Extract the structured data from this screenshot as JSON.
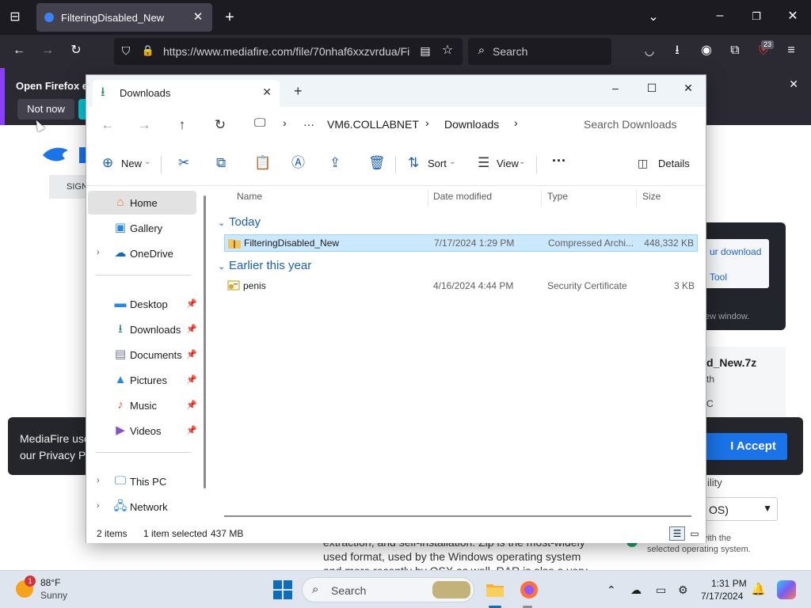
{
  "browser": {
    "tab_title": "FilteringDisabled_New",
    "url": "https://www.mediafire.com/file/70nhaf6xxzvrdua/Fi",
    "search_placeholder": "Search",
    "extension_badge": "23"
  },
  "webpage": {
    "notification_title": "Open Firefox ev",
    "not_now_label": "Not now",
    "sign_fragment": "SIGN",
    "download_link_1": "ur download",
    "download_link_2": "Tool",
    "new_window_note": "ew window.",
    "filename_fragment": "d_New.7z",
    "frag_th": "th",
    "frag_c": "C",
    "cookie_line1": "MediaFire use",
    "cookie_line2": "our Privacy Po",
    "accept_label": "I Accept",
    "compat_fragment": "ility",
    "os_select_value": "OS)",
    "os_note_1": "e with the",
    "os_note_2": "selected operating system.",
    "body_line1": "extraction, and self-installation. Zip is the most-widely",
    "body_line2": "used format, used by the Windows operating system",
    "body_line3": "and more recently by OSX as well. RAR is also a very"
  },
  "explorer": {
    "tab_label": "Downloads",
    "breadcrumb": [
      "VM6.COLLABNET",
      "Downloads"
    ],
    "breadcrumb_more": "···",
    "search_placeholder": "Search Downloads",
    "toolbar": {
      "new_label": "New",
      "sort_label": "Sort",
      "view_label": "View",
      "more_label": "···",
      "details_label": "Details"
    },
    "nav": {
      "home": "Home",
      "gallery": "Gallery",
      "onedrive": "OneDrive",
      "desktop": "Desktop",
      "downloads": "Downloads",
      "documents": "Documents",
      "pictures": "Pictures",
      "music": "Music",
      "videos": "Videos",
      "this_pc": "This PC",
      "network": "Network"
    },
    "columns": {
      "name": "Name",
      "date_modified": "Date modified",
      "type": "Type",
      "size": "Size"
    },
    "groups": [
      {
        "label": "Today",
        "files": [
          {
            "name": "FilteringDisabled_New",
            "date": "7/17/2024 1:29 PM",
            "type": "Compressed Archi...",
            "size": "448,332 KB",
            "selected": true
          }
        ]
      },
      {
        "label": "Earlier this year",
        "files": [
          {
            "name": "penis",
            "date": "4/16/2024 4:44 PM",
            "type": "Security Certificate",
            "size": "3 KB",
            "selected": false
          }
        ]
      }
    ],
    "status": {
      "item_count": "2 items",
      "selection": "1 item selected",
      "selection_size": "437 MB"
    }
  },
  "taskbar": {
    "weather_badge": "1",
    "weather_temp": "88°F",
    "weather_condition": "Sunny",
    "search_label": "Search",
    "clock_time": "1:31 PM",
    "clock_date": "7/17/2024"
  },
  "colors": {
    "accent": "#1a5fb4",
    "selection": "#cce8ff",
    "firefox_dark": "#1c1b22",
    "accept_button": "#1a73e8"
  }
}
